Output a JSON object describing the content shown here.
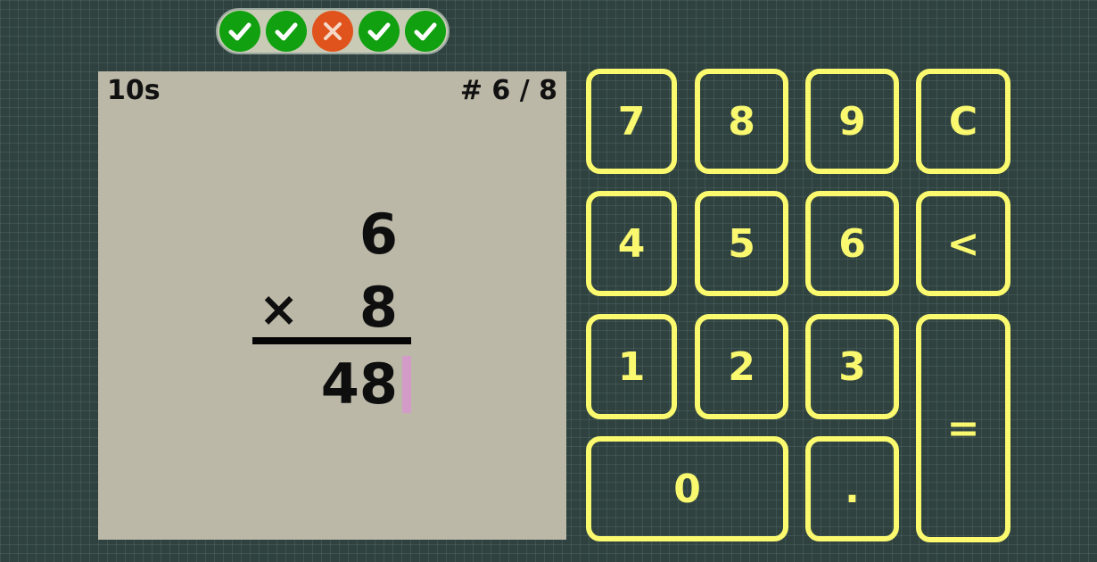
{
  "progress": {
    "results": [
      {
        "status": "correct",
        "icon": "check-icon",
        "color": "#11a010"
      },
      {
        "status": "correct",
        "icon": "check-icon",
        "color": "#11a010"
      },
      {
        "status": "wrong",
        "icon": "cross-icon",
        "color": "#e0531c"
      },
      {
        "status": "correct",
        "icon": "check-icon",
        "color": "#11a010"
      },
      {
        "status": "correct",
        "icon": "check-icon",
        "color": "#11a010"
      }
    ]
  },
  "problem": {
    "timer": "10s",
    "counter": "# 6 / 8",
    "operand1": "6",
    "operator": "×",
    "operand2": "8",
    "answer": "48"
  },
  "keypad": {
    "key_7": "7",
    "key_8": "8",
    "key_9": "9",
    "key_clear": "C",
    "key_4": "4",
    "key_5": "5",
    "key_6": "6",
    "key_backspace": "<",
    "key_1": "1",
    "key_2": "2",
    "key_3": "3",
    "key_equals": "=",
    "key_0": "0",
    "key_decimal": "."
  },
  "colors": {
    "background": "#2f4240",
    "card": "#bbb8a8",
    "keypad_accent": "#fbfa6f",
    "correct": "#11a010",
    "wrong": "#e0531c",
    "caret": "#d39cc8"
  }
}
